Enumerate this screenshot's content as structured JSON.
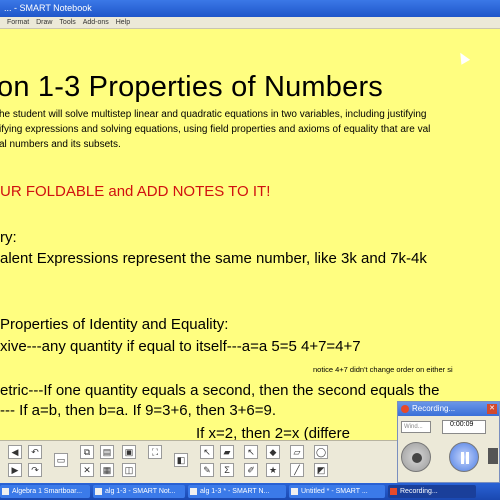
{
  "window": {
    "title": "... - SMART Notebook"
  },
  "menubar": {
    "items": [
      "Format",
      "Draw",
      "Tools",
      "Add-ons",
      "Help"
    ]
  },
  "lesson": {
    "title": "on 1-3  Properties of Numbers",
    "objective_lines": [
      "he student will solve multistep linear and quadratic equations in two variables, including justifying",
      "ifying expressions and solving equations, using field properties and axioms of equality that are val",
      "al numbers and its subsets."
    ],
    "foldable": "UR FOLDABLE and ADD NOTES TO IT!",
    "vocab_heading": "ry:",
    "equiv_line": "alent Expressions represent the same number, like 3k and 7k-4k",
    "properties_heading": "Properties of Identity and Equality:",
    "reflexive_line": "xive---any quantity if equal to itself---a=a     5=5     4+7=4+7",
    "notice_line": "notice 4+7 didn't change order on either si",
    "symmetric_line": "etric---If one quantity equals a second, then the second equals the",
    "symmetric_ex": "---     If a=b, then b=a.          If 9=3+6, then 3+6=9.",
    "transitive_partial": "If x=2, then 2=x     (differe"
  },
  "recorder": {
    "title": "Recording...",
    "mode_label": "Wind...",
    "time": "0:00:09"
  },
  "taskbar": {
    "tasks": [
      "Algebra 1 Smartboar...",
      "alg 1-3 - SMART Not...",
      "alg 1-3 * - SMART N...",
      "Untitled * - SMART ...",
      "Recording..."
    ]
  }
}
